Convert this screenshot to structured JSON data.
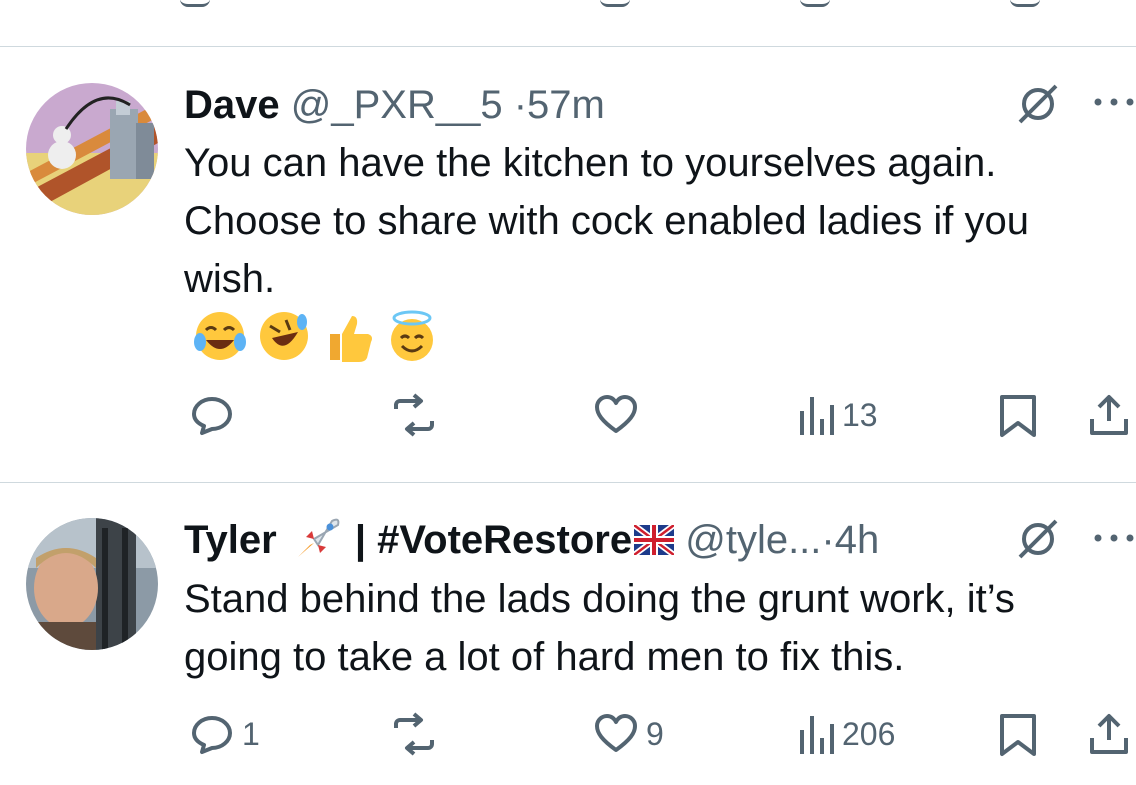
{
  "tweets": [
    {
      "name": "Dave",
      "handle": "@_PXR__5",
      "dot": "·",
      "time": "57m",
      "body": "You can have the kitchen to yourselves again.\nChoose to share with cock enabled ladies if you\nwish.",
      "emojis": [
        "face-with-tears-of-joy",
        "rolling-on-floor-laughing",
        "thumbs-up",
        "smiling-face-with-halo"
      ],
      "actions": {
        "replies": "",
        "reposts": "",
        "likes": "",
        "views": "13"
      }
    },
    {
      "name": "Tyler",
      "name_suffix": " | #VoteRestore",
      "handle": "@tyle...",
      "dot": "·",
      "time": "4h",
      "body": "Stand behind the lads doing the grunt work, it’s\ngoing to take a lot of hard men to fix this.",
      "actions": {
        "replies": "1",
        "reposts": "",
        "likes": "9",
        "views": "206"
      }
    }
  ],
  "colors": {
    "text": "#0f1419",
    "secondary": "#536471",
    "divider": "#cfd9de"
  }
}
